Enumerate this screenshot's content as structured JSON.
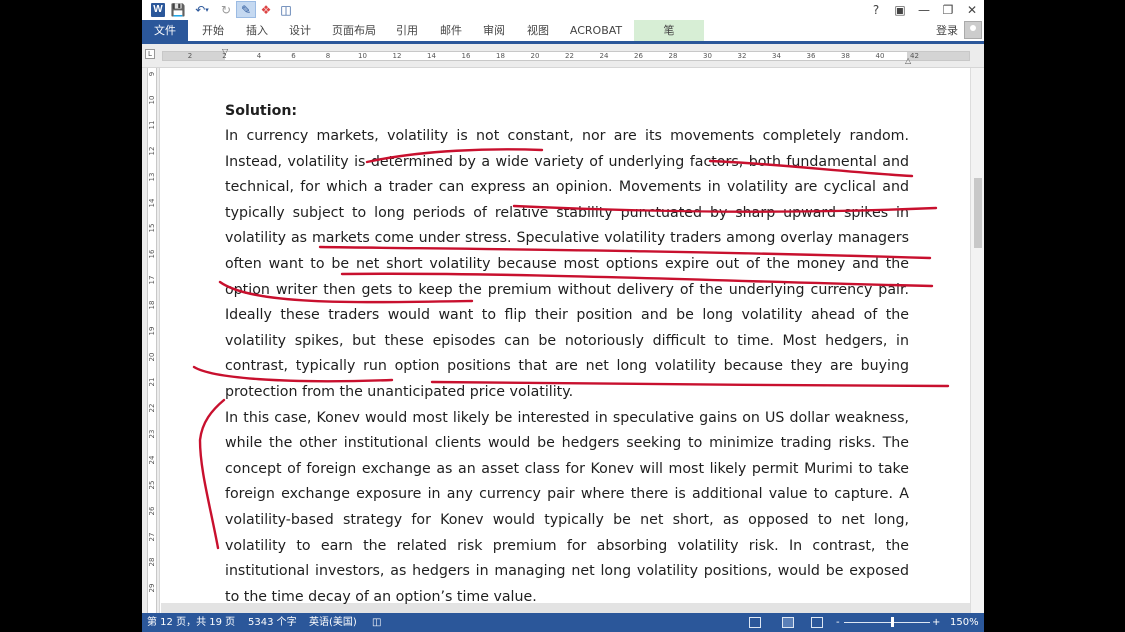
{
  "titlebar": {
    "word_icon": "W",
    "quick_access": [
      "save-icon",
      "undo-icon",
      "redo-icon",
      "pen-icon",
      "eraser-icon",
      "layout-icon"
    ],
    "help": "?"
  },
  "ribbon": {
    "tabs": [
      "文件",
      "开始",
      "插入",
      "设计",
      "页面布局",
      "引用",
      "邮件",
      "审阅",
      "视图",
      "ACROBAT",
      "笔"
    ],
    "login": "登录"
  },
  "ruler": {
    "h_ticks": [
      "2",
      "2",
      "4",
      "6",
      "8",
      "10",
      "12",
      "14",
      "16",
      "18",
      "20",
      "22",
      "24",
      "26",
      "28",
      "30",
      "32",
      "34",
      "36",
      "38",
      "40",
      "42"
    ],
    "v_ticks": [
      "9",
      "10",
      "11",
      "12",
      "13",
      "14",
      "15",
      "16",
      "17",
      "18",
      "19",
      "20",
      "21",
      "22",
      "23",
      "24",
      "25",
      "26",
      "27",
      "28",
      "29"
    ]
  },
  "document": {
    "heading": "Solution:",
    "paragraph1": "In currency markets, volatility is not constant, nor are its movements completely random. Instead, volatility is determined by a wide variety of underlying factors, both fundamental and technical, for which a trader can express an opinion. Movements in volatility are cyclical and typically subject to long periods of relative stability punctuated by sharp upward spikes in volatility as markets come under stress. Speculative volatility traders among overlay managers often want to be net short volatility because most options expire out of the money and the option writer then gets to keep the premium without delivery of the underlying currency pair. Ideally these traders would want to flip their position and be long volatility ahead of the volatility spikes, but these episodes can be notoriously difficult to time. Most hedgers, in contrast, typically run option positions that are net long volatility because they are buying protection from the unanticipated price volatility.",
    "paragraph2": "In this case, Konev would most likely be interested in speculative gains on US dollar weakness, while the other institutional clients would be hedgers seeking to minimize trading risks. The concept of foreign exchange as an asset class for Konev will most likely permit Murimi to take foreign exchange exposure in any currency pair where there is additional value to capture. A volatility-based strategy for Konev would typically be net short, as opposed to net long, volatility to earn the related risk premium for absorbing volatility risk. In contrast, the institutional investors, as hedgers in managing net long volatility positions, would be exposed to the time decay of an option’s time value."
  },
  "status": {
    "page": "第 12 页，共 19 页",
    "words": "5343 个字",
    "language": "英语(美国)",
    "zoom_minus": "-",
    "zoom_plus": "+",
    "zoom": "150%"
  },
  "colors": {
    "accent": "#2b579a",
    "ink": "#c8102e",
    "pen_tab": "#d7eed5"
  }
}
